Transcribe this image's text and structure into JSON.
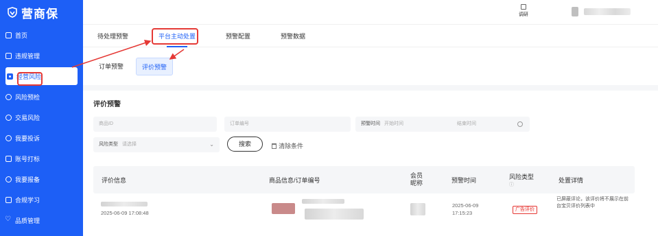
{
  "brand": {
    "name": "营商保"
  },
  "sidebar": {
    "items": [
      {
        "label": "首页",
        "icon": "home-icon"
      },
      {
        "label": "违规管理",
        "icon": "violation-icon"
      },
      {
        "label": "经营风险",
        "icon": "risk-icon",
        "active": true
      },
      {
        "label": "风险预检",
        "icon": "precheck-icon"
      },
      {
        "label": "交易风险",
        "icon": "trade-icon"
      },
      {
        "label": "我要投诉",
        "icon": "complaint-icon"
      },
      {
        "label": "账号打标",
        "icon": "tag-icon"
      },
      {
        "label": "我要报备",
        "icon": "report-icon"
      },
      {
        "label": "合规学习",
        "icon": "study-icon"
      },
      {
        "label": "品质管理",
        "icon": "quality-icon"
      }
    ]
  },
  "header": {
    "research_label": "调研"
  },
  "tabs": [
    {
      "label": "待处理预警"
    },
    {
      "label": "平台主动处置",
      "active": true
    },
    {
      "label": "预警配置"
    },
    {
      "label": "预警数据"
    }
  ],
  "subtabs": [
    {
      "label": "订单预警"
    },
    {
      "label": "评价预警",
      "active": true
    }
  ],
  "section": {
    "title": "评价预警"
  },
  "filters": {
    "product_id_placeholder": "商品ID",
    "order_no_placeholder": "订单编号",
    "warn_time_label": "预警时间",
    "start_placeholder": "开始时间",
    "end_placeholder": "结束时间",
    "risk_type_label": "风险类型",
    "risk_type_placeholder": "请选择",
    "search_label": "搜索",
    "clear_label": "清除条件"
  },
  "table": {
    "headers": {
      "review_info": "评价信息",
      "product_order": "商品信息/订单编号",
      "nickname": "会员昵称",
      "warn_time": "预警时间",
      "risk_type": "风险类型",
      "detail": "处置详情"
    },
    "rows": [
      {
        "review_time": "2025-06-09 17:08:48",
        "warn_time": "2025-06-09 17:15:23",
        "risk_type": "广告评价",
        "detail": "已屏蔽评论，该评价将不展示在前台宝贝评价列表中"
      }
    ]
  },
  "colors": {
    "primary": "#1d5ff6",
    "annotation": "#e53935"
  }
}
